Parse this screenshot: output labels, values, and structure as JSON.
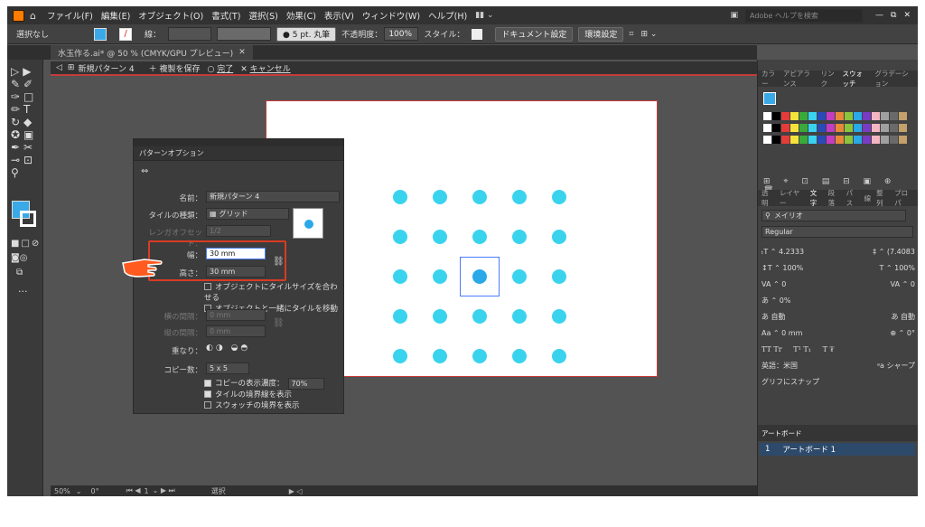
{
  "menu": {
    "items": [
      "ファイル(F)",
      "編集(E)",
      "オブジェクト(O)",
      "書式(T)",
      "選択(S)",
      "効果(C)",
      "表示(V)",
      "ウィンドウ(W)",
      "ヘルプ(H)"
    ],
    "search_placeholder": "Adobe ヘルプを検索"
  },
  "control": {
    "selection": "選択なし",
    "stroke_label": "線：",
    "brush": "● 5 pt. 丸筆",
    "opacity_label": "不透明度：",
    "opacity": "100%",
    "style_label": "スタイル：",
    "doc_settings": "ドキュメント設定",
    "env_settings": "環境設定"
  },
  "tab": {
    "doc": "水玉作る.ai* @ 50 % (CMYK/GPU プレビュー)"
  },
  "isolation": {
    "label": "新規パターン 4",
    "save_copy": "＋ 複製を保存",
    "done": "完了",
    "cancel": "キャンセル"
  },
  "dialog": {
    "title": "パターンオプション",
    "name_label": "名前：",
    "name": "新規パターン 4",
    "tile_type_label": "タイルの種類：",
    "tile_type": "グリッド",
    "brick_offset_label": "レンガオフセット：",
    "brick_offset": "1/2",
    "width_label": "幅：",
    "width": "30 mm",
    "height_label": "高さ：",
    "height": "30 mm",
    "fit_tile": "オブジェクトにタイルサイズを合わせる",
    "move_tile": "オブジェクトと一緒にタイルを移動",
    "h_spacing_label": "横の間隔：",
    "h_spacing": "0 mm",
    "v_spacing_label": "縦の間隔：",
    "v_spacing": "0 mm",
    "overlap_label": "重なり：",
    "copies_label": "コピー数：",
    "copies": "5 x 5",
    "dim_copies": "コピーの表示濃度：",
    "dim_value": "70%",
    "show_tile_edge": "タイルの境界線を表示",
    "show_swatch_bounds": "スウォッチの境界を表示"
  },
  "pattern": {
    "rows": 5,
    "cols": 5,
    "color": "#3ad3ee",
    "center_color": "#2aa8e8"
  },
  "right_panel": {
    "tabs": [
      "カラー",
      "アピアランス",
      "リンク",
      "スウォッチ",
      "グラデーション"
    ],
    "char_tabs": [
      "透明",
      "レイヤー",
      "文字",
      "段落",
      "パス",
      "線",
      "整列",
      "プロパ"
    ],
    "font": "メイリオ",
    "style": "Regular",
    "size": "4.2333",
    "leading": "(7.4083",
    "scale_v": "100%",
    "scale_h": "100%",
    "kern": "0",
    "track": "0",
    "tsume": "0%",
    "auto1": "自動",
    "auto2": "自動",
    "baseline": "0 mm",
    "rotate": "0°",
    "language": "英語：米国",
    "aa": "シャープ",
    "snap": "グリフにスナップ",
    "artboard_tab": "アートボード",
    "artboard_num": "1",
    "artboard_name": "アートボード 1"
  },
  "status": {
    "zoom": "50%",
    "angle": "0°",
    "page": "1",
    "tool": "選択"
  }
}
